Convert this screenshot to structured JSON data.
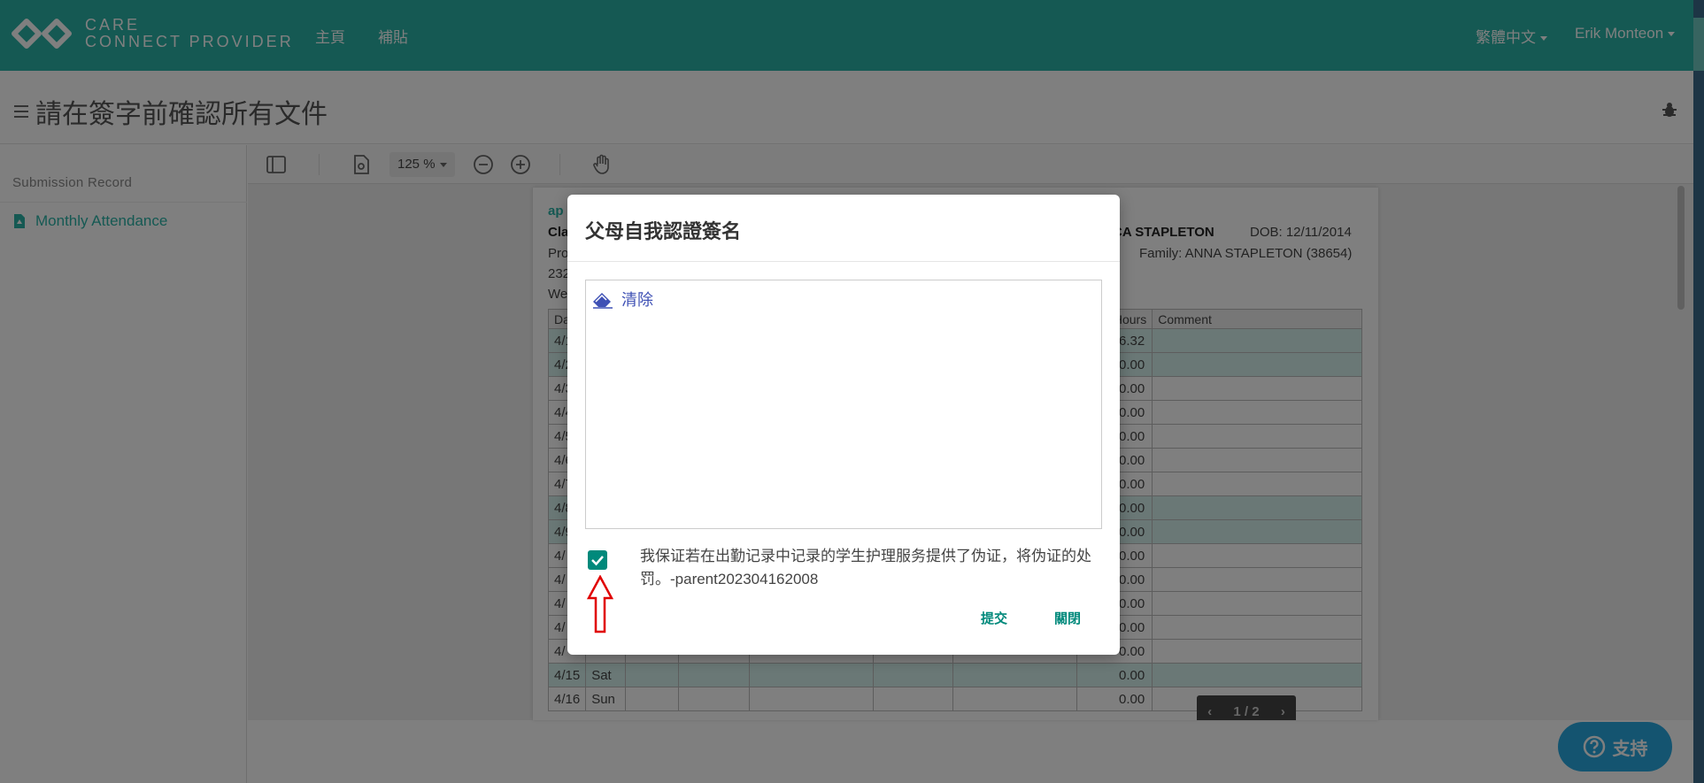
{
  "navbar": {
    "logo_line1": "CARE",
    "logo_line2": "CONNECT PROVIDER",
    "links": [
      "主頁",
      "補貼"
    ],
    "language": "繁體中文",
    "user": "Erik Monteon"
  },
  "page": {
    "title": "請在簽字前確認所有文件"
  },
  "sidebar": {
    "title": "Submission Record",
    "items": [
      {
        "label": "Monthly Attendance",
        "icon": "pdf-file-icon"
      }
    ]
  },
  "viewer": {
    "zoom": "125 %",
    "pager": "1 / 2"
  },
  "document": {
    "heading_fragment": "ap",
    "class_fragment": "Cla",
    "pro_fragment": "Pro",
    "addr_fragment": "232",
    "week_fragment": "We",
    "child_name_fragment": "NICA STAPLETON",
    "dob": "DOB: 12/11/2014",
    "family": "Family: ANNA STAPLETON (38654)",
    "col_date_fragment": "Da",
    "col_hours_fragment": "al Hours",
    "col_comment": "Comment",
    "rows": [
      {
        "date": "4/1",
        "day": "",
        "hours": "6.32",
        "shade": true
      },
      {
        "date": "4/2",
        "day": "",
        "hours": "0.00",
        "shade": true
      },
      {
        "date": "4/3",
        "day": "",
        "hours": "0.00",
        "shade": false
      },
      {
        "date": "4/4",
        "day": "",
        "hours": "0.00",
        "shade": false
      },
      {
        "date": "4/5",
        "day": "",
        "hours": "0.00",
        "shade": false
      },
      {
        "date": "4/6",
        "day": "",
        "hours": "0.00",
        "shade": false
      },
      {
        "date": "4/7",
        "day": "",
        "hours": "0.00",
        "shade": false
      },
      {
        "date": "4/8",
        "day": "",
        "hours": "0.00",
        "shade": true
      },
      {
        "date": "4/9",
        "day": "",
        "hours": "0.00",
        "shade": true
      },
      {
        "date": "4/",
        "day": "",
        "hours": "0.00",
        "shade": false
      },
      {
        "date": "4/",
        "day": "",
        "hours": "0.00",
        "shade": false
      },
      {
        "date": "4/",
        "day": "",
        "hours": "0.00",
        "shade": false
      },
      {
        "date": "4/",
        "day": "",
        "hours": "0.00",
        "shade": false
      },
      {
        "date": "4/",
        "day": "",
        "hours": "0.00",
        "shade": false
      },
      {
        "date": "4/15",
        "day": "Sat",
        "hours": "0.00",
        "shade": true
      },
      {
        "date": "4/16",
        "day": "Sun",
        "hours": "0.00",
        "shade": false
      }
    ]
  },
  "modal": {
    "title": "父母自我認證簽名",
    "clear_label": "清除",
    "checkbox_checked": true,
    "certification_text": "我保证若在出勤记录中记录的学生护理服务提供了伪证，将伪证的处罚。-parent202304162008",
    "submit_label": "提交",
    "close_label": "關閉"
  },
  "support": {
    "label": "支持"
  },
  "colors": {
    "brand_teal": "#2ab3a6",
    "checkbox_teal": "#00897b",
    "link_blue": "#3f51b5",
    "support_blue": "#29a9e0",
    "arrow_red": "#e00000"
  }
}
